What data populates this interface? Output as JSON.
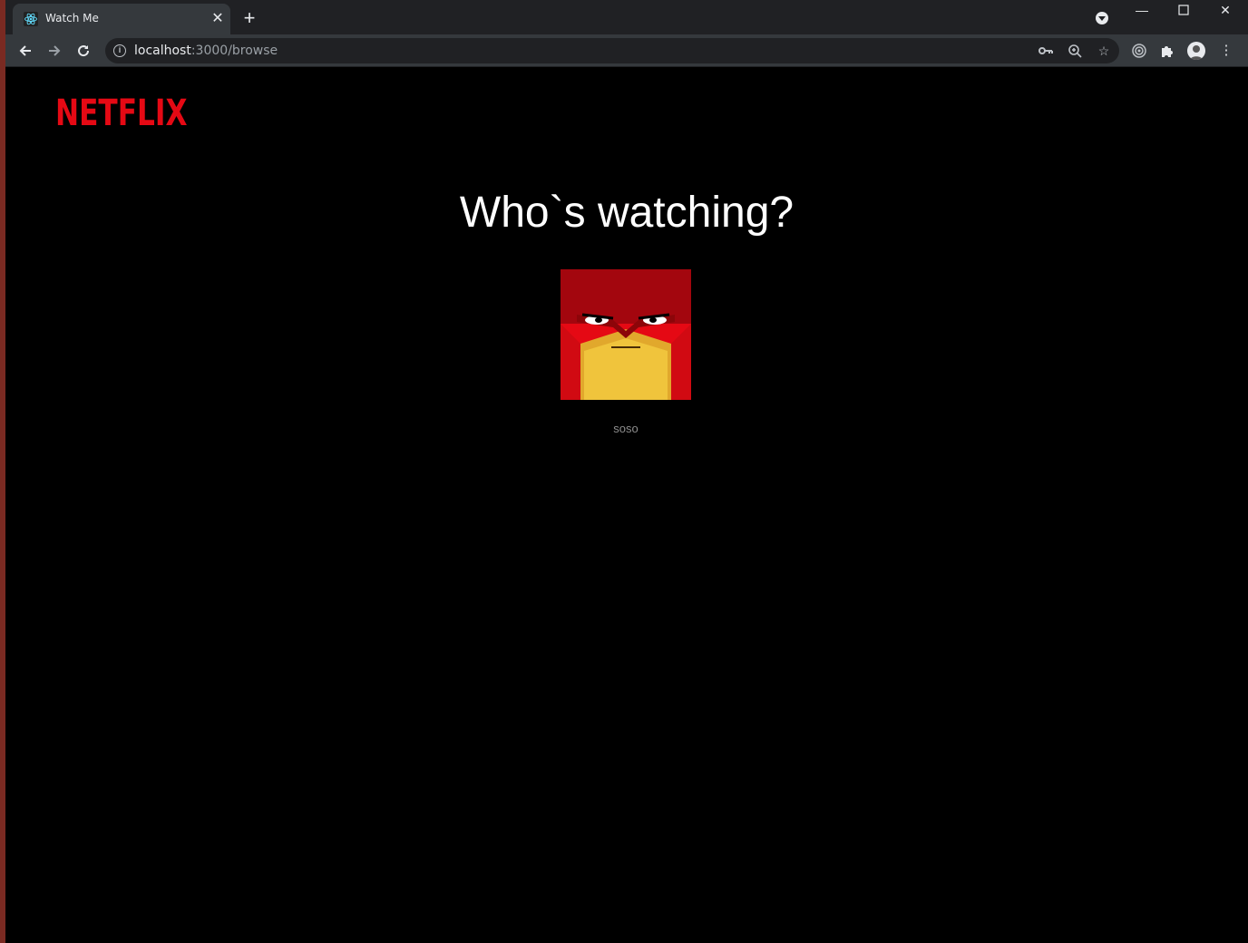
{
  "browser": {
    "tab_title": "Watch Me",
    "url_host": "localhost",
    "url_path": ":3000/browse"
  },
  "page": {
    "logo": "NETFLIX",
    "heading": "Who`s watching?",
    "profiles": [
      {
        "name": "soso"
      }
    ]
  },
  "colors": {
    "brand": "#e50914",
    "background": "#000000",
    "profile_name": "#8c8c8c"
  }
}
